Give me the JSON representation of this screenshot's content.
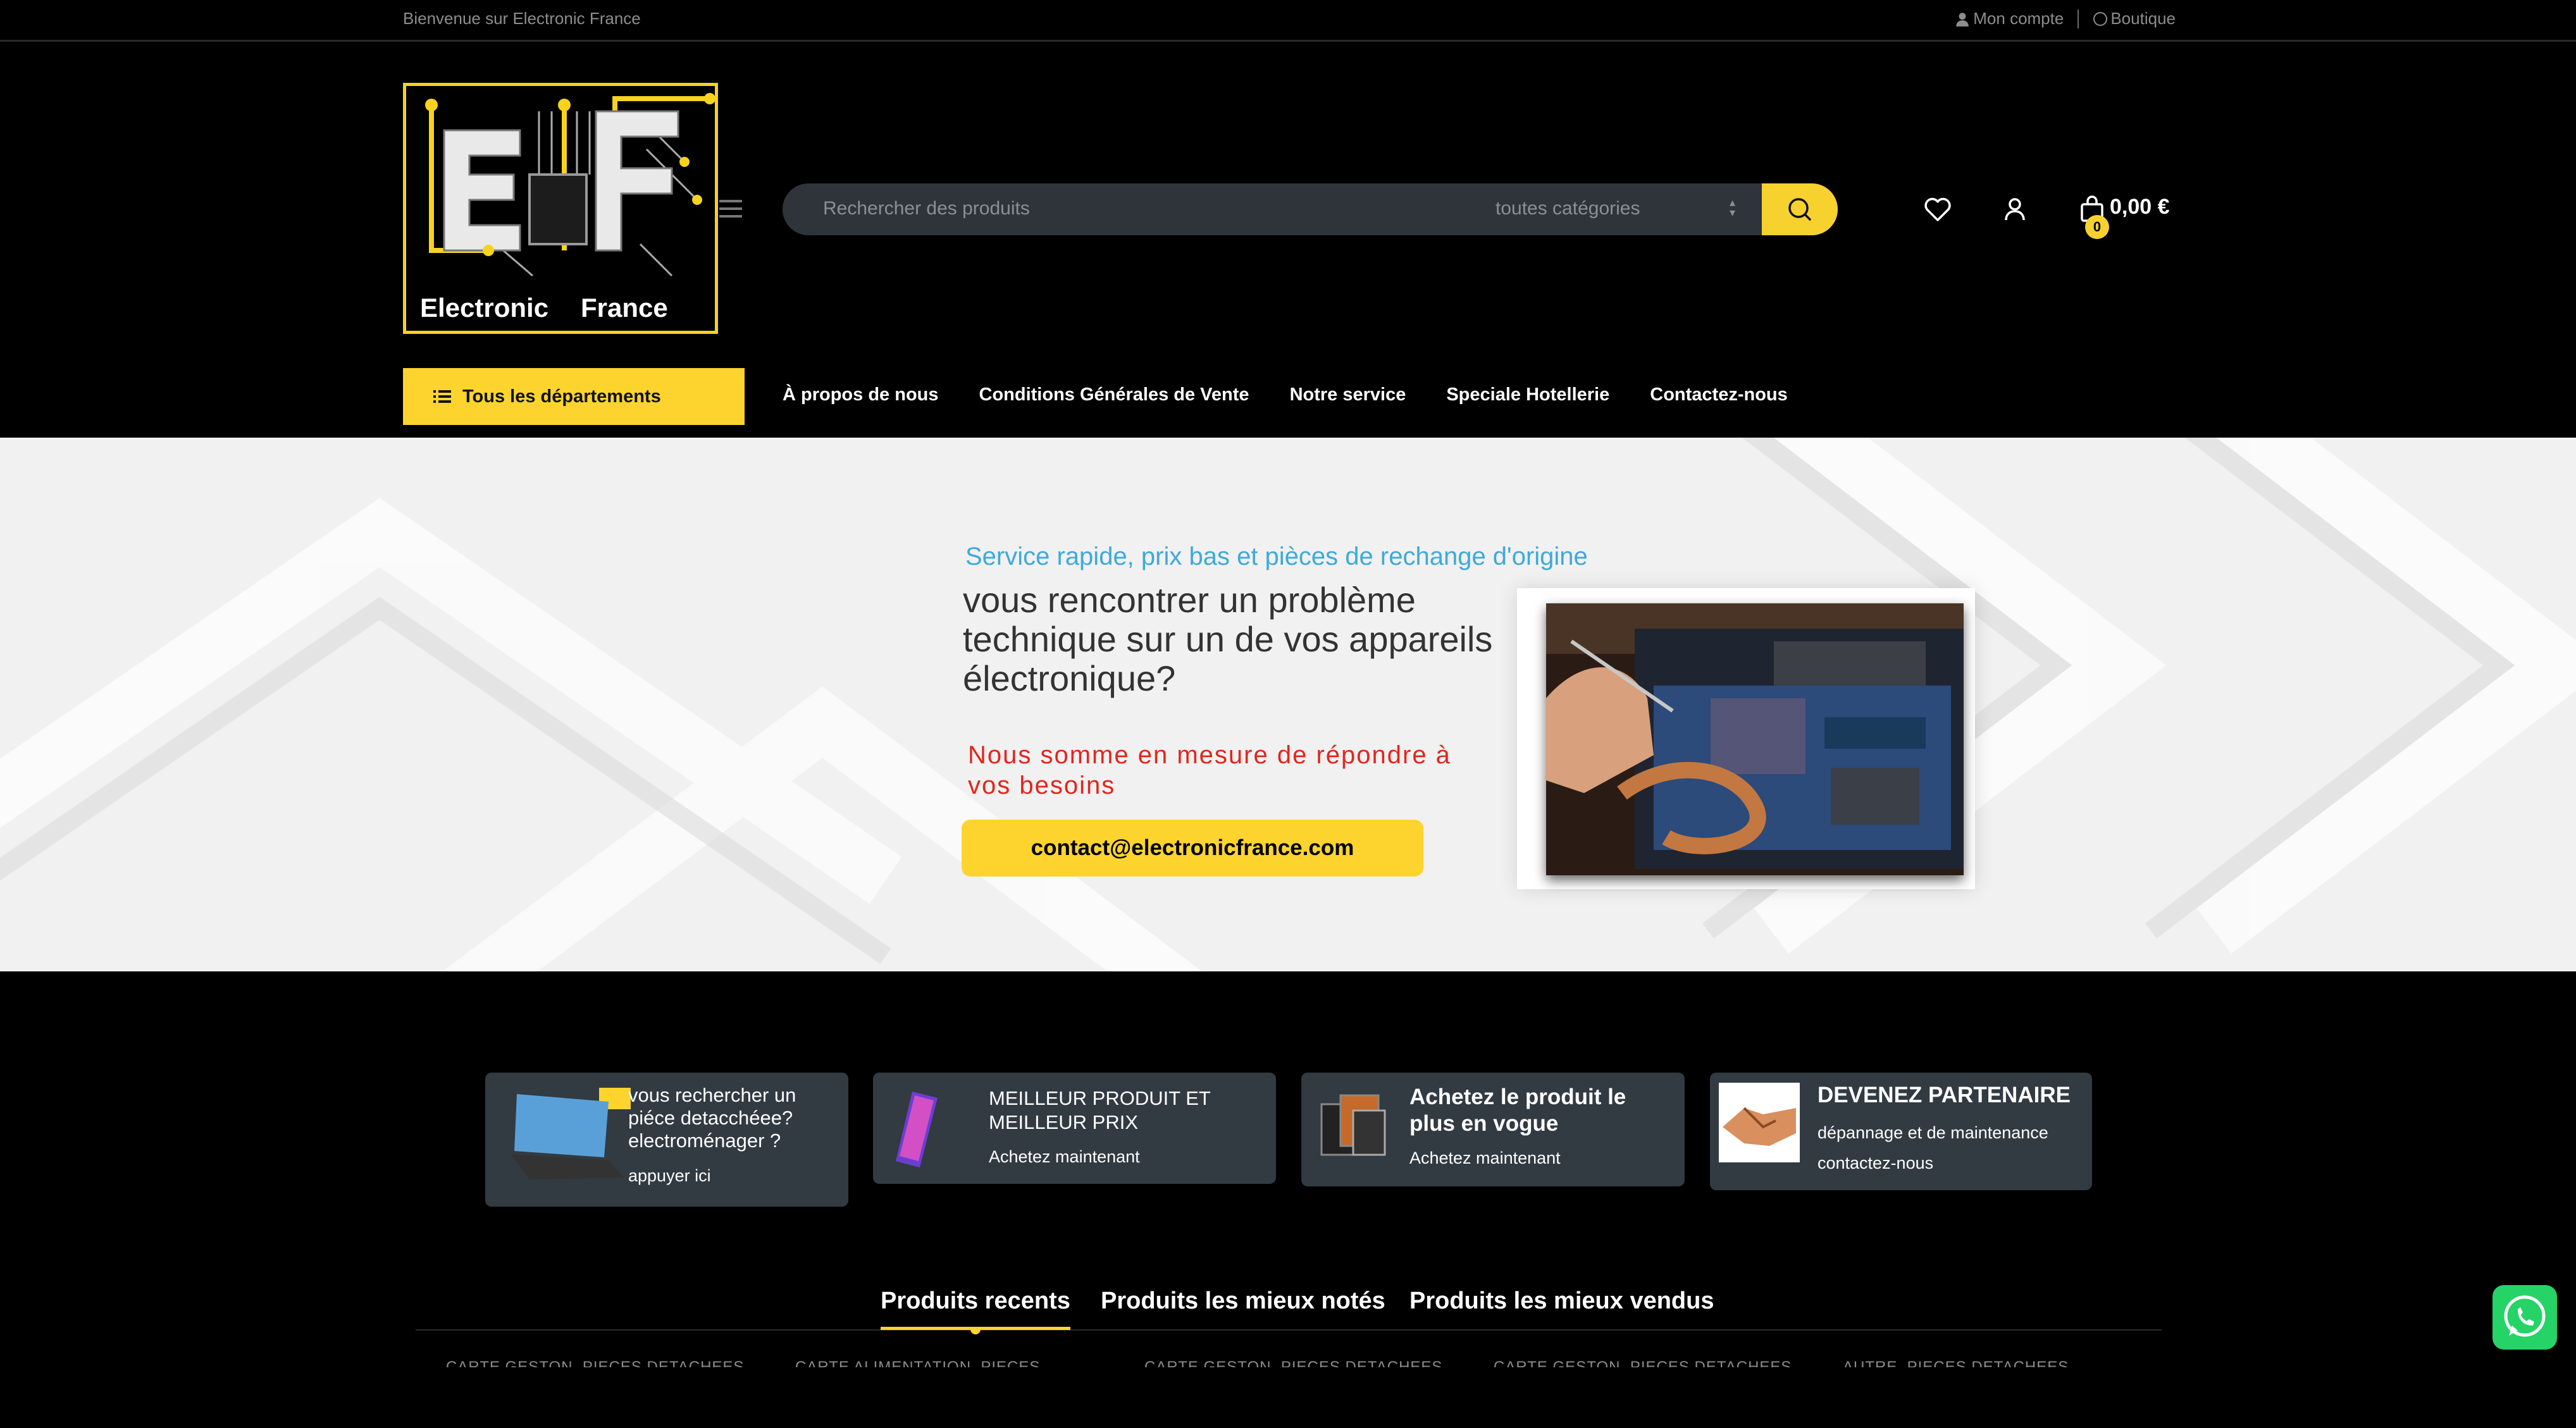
{
  "topbar": {
    "welcome": "Bienvenue sur Electronic France",
    "account_link": "Mon compte",
    "shop_link": "Boutique"
  },
  "logo": {
    "word1": "Electronic",
    "word2": "France"
  },
  "search": {
    "placeholder": "Rechercher des produits",
    "category": "toutes catégories"
  },
  "cart": {
    "count": "0",
    "total": "0,00 €"
  },
  "nav": {
    "departments": "Tous les départements",
    "items": [
      "À propos de nous",
      "Conditions Générales de Vente",
      "Notre service",
      "Speciale Hotellerie",
      "Contactez-nous"
    ]
  },
  "hero": {
    "tagline": "Service rapide, prix bas et pièces de rechange d'origine",
    "headline": "vous rencontrer un problème technique sur un de vos appareils électronique?",
    "subtext": "Nous somme en mesure de répondre à vos besoins",
    "email_button": "contact@electronicfrance.com"
  },
  "promos": [
    {
      "title": "vous rechercher un piéce detacchéee? electroménager ?",
      "sub": "appuyer ici"
    },
    {
      "title": "MEILLEUR PRODUIT ET MEILLEUR PRIX",
      "sub": "Achetez maintenant"
    },
    {
      "title": "Achetez le produit le plus en vogue",
      "sub": "Achetez maintenant"
    },
    {
      "title": "DEVENEZ PARTENAIRE",
      "sub1": "dépannage et de maintenance",
      "sub2": "contactez-nous"
    }
  ],
  "tabs": [
    "Produits recents",
    "Produits les mieux notés",
    "Produits les mieux vendus"
  ],
  "products_peek": [
    "CARTE GESTON, PIECES DETACHEES",
    "CARTE ALIMENTATION, PIECES",
    "CARTE GESTON, PIECES DETACHEES",
    "CARTE GESTON, PIECES DETACHEES",
    "AUTRE, PIECES DETACHEES"
  ],
  "colors": {
    "accent": "#fdd42e",
    "tagline": "#3fa9d9",
    "alert": "#e1261c",
    "card": "#323a42"
  },
  "icons": [
    "user-icon",
    "info-icon",
    "menu-icon",
    "search-icon",
    "heart-icon",
    "account-icon",
    "bag-icon",
    "list-icon",
    "whatsapp-icon"
  ]
}
